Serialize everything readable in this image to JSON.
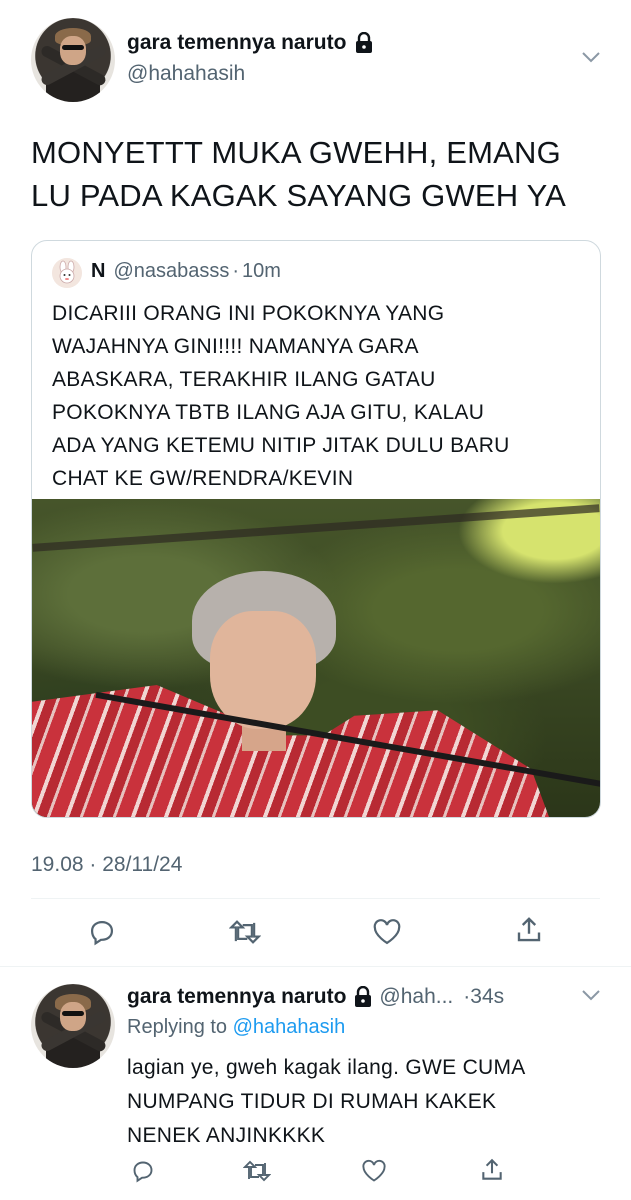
{
  "main_tweet": {
    "author_name": "gara temennya naruto",
    "author_handle": "@hahahasih",
    "text_line1": "MONYETTT MUKA GWEHH, EMANG",
    "text_line2": "LU PADA KAGAK SAYANG GWEH YA",
    "timestamp": "19.08 · 28/11/24"
  },
  "quoted_tweet": {
    "author_name": "N",
    "author_handle": "@nasabasss",
    "separator": "·",
    "time": "10m",
    "text_lines": [
      "DICARIII ORANG INI POKOKNYA YANG",
      "WAJAHNYA GINI!!!! NAMANYA GARA",
      "ABASKARA, TERAKHIR ILANG GATAU",
      "POKOKNYA TBTB ILANG AJA GITU, KALAU",
      "ADA YANG KETEMU NITIP JITAK DULU BARU",
      "CHAT KE GW/RENDRA/KEVIN"
    ]
  },
  "reply_tweet": {
    "author_name": "gara temennya naruto",
    "author_handle": "@hah...",
    "time": "·34s",
    "replying_prefix": "Replying to",
    "replying_handle": "@hahahasih",
    "text_lines": [
      "lagian ye, gweh kagak ilang. GWE CUMA",
      "NUMPANG TIDUR DI RUMAH KAKEK",
      "NENEK ANJINKKKK"
    ]
  },
  "icons": {
    "lock": "lock-icon",
    "more": "chevron-down-icon",
    "reply": "reply-icon",
    "retweet": "retweet-icon",
    "like": "like-icon",
    "share": "share-icon"
  },
  "colors": {
    "text": "#0f1419",
    "secondary": "#536471",
    "link": "#1d9bf0",
    "border": "#cfd9de",
    "divider": "#eff3f4"
  }
}
